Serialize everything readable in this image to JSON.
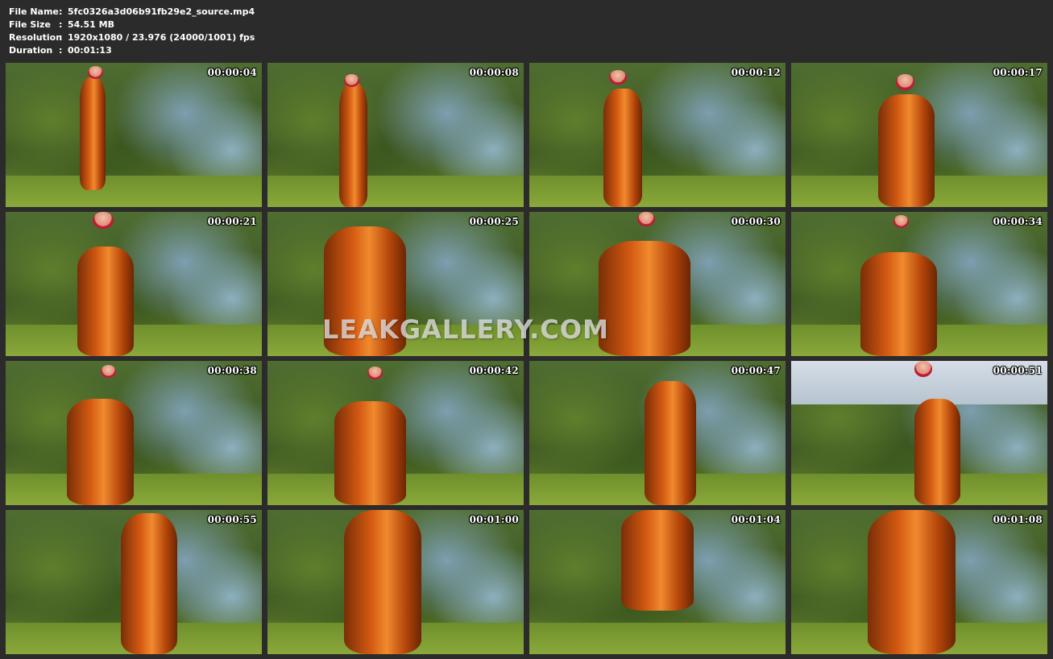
{
  "info": {
    "rows": [
      {
        "label": "File Name",
        "value": "5fc0326a3d06b91fb29e2_source.mp4"
      },
      {
        "label": "File Size",
        "value": "54.51 MB"
      },
      {
        "label": "Resolution",
        "value": "1920x1080 / 23.976 (24000/1001) fps"
      },
      {
        "label": "Duration",
        "value": "00:01:13"
      }
    ],
    "separator": ":"
  },
  "thumbnails": [
    {
      "timestamp": "00:00:04"
    },
    {
      "timestamp": "00:00:08"
    },
    {
      "timestamp": "00:00:12"
    },
    {
      "timestamp": "00:00:17"
    },
    {
      "timestamp": "00:00:21"
    },
    {
      "timestamp": "00:00:25"
    },
    {
      "timestamp": "00:00:30"
    },
    {
      "timestamp": "00:00:34"
    },
    {
      "timestamp": "00:00:38"
    },
    {
      "timestamp": "00:00:42"
    },
    {
      "timestamp": "00:00:47"
    },
    {
      "timestamp": "00:00:51"
    },
    {
      "timestamp": "00:00:55"
    },
    {
      "timestamp": "00:01:00"
    },
    {
      "timestamp": "00:01:04"
    },
    {
      "timestamp": "00:01:08"
    }
  ],
  "watermark": "LEAKGALLERY.COM",
  "colors": {
    "background": "#2b2b2b",
    "text": "#ffffff",
    "dress": "#d45a12",
    "hair": "#c4203a"
  }
}
